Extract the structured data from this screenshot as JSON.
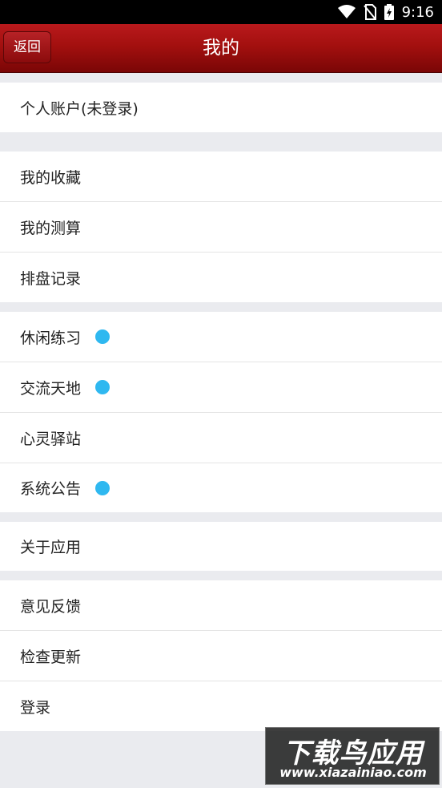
{
  "status_bar": {
    "time": "9:16",
    "icons": [
      "wifi-icon",
      "no-sim-icon",
      "battery-charging-icon"
    ]
  },
  "nav": {
    "back_label": "返回",
    "title": "我的"
  },
  "sections": [
    {
      "items": [
        {
          "label": "个人账户(未登录)",
          "badge": false
        }
      ]
    },
    {
      "items": [
        {
          "label": "我的收藏",
          "badge": false
        },
        {
          "label": "我的测算",
          "badge": false
        },
        {
          "label": "排盘记录",
          "badge": false
        }
      ]
    },
    {
      "items": [
        {
          "label": "休闲练习",
          "badge": true
        },
        {
          "label": "交流天地",
          "badge": true
        },
        {
          "label": "心灵驿站",
          "badge": false
        },
        {
          "label": "系统公告",
          "badge": true
        }
      ]
    },
    {
      "items": [
        {
          "label": "关于应用",
          "badge": false
        }
      ]
    },
    {
      "items": [
        {
          "label": "意见反馈",
          "badge": false
        },
        {
          "label": "检查更新",
          "badge": false
        },
        {
          "label": "登录",
          "badge": false
        }
      ]
    }
  ],
  "colors": {
    "nav_red": "#a3100f",
    "badge_blue": "#2fb8f0",
    "background": "#eaebef"
  },
  "watermark": {
    "main": "下载鸟应用",
    "sub": "www.xiazainiao.com"
  }
}
